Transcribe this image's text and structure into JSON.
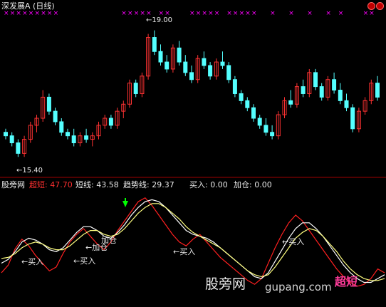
{
  "header": {
    "title": "深发展A (日线)",
    "max_label": "19.00",
    "min_label": "15.40"
  },
  "indicator": {
    "name": "股旁网",
    "super_short_label": "超短:",
    "super_short_value": "47.70",
    "short_label": "短线:",
    "short_value": "43.58",
    "trend_label": "趋势线:",
    "trend_value": "29.37",
    "buy_label": "买入:",
    "buy_value": "0.00",
    "add_label": "加仓:",
    "add_value": "0.00"
  },
  "annotations": {
    "buy": "买入",
    "add_position": "加仓"
  },
  "watermark": {
    "site_cn": "股旁网",
    "site_domain": "gupang.com",
    "logo_text": "超短"
  },
  "colors": {
    "background": "#000000",
    "up_candle": "#ff3232",
    "down_candle": "#54ffff",
    "signal_mark": "#ff00ff",
    "super_short_line": "#ff2020",
    "short_line": "#ffffff",
    "trend_line": "#ffff80",
    "divider": "#a00000",
    "arrow": "#00ff00"
  },
  "chart_data": [
    {
      "type": "candlestick",
      "title": "深发展A (日线)",
      "series": [
        {
          "name": "price",
          "values": [
            [
              16.1,
              16.2,
              15.9,
              16.0
            ],
            [
              16.0,
              16.1,
              15.7,
              15.8
            ],
            [
              15.8,
              15.9,
              15.4,
              15.5
            ],
            [
              15.5,
              16.0,
              15.4,
              15.9
            ],
            [
              15.9,
              16.4,
              15.8,
              16.3
            ],
            [
              16.3,
              16.6,
              16.1,
              16.5
            ],
            [
              16.5,
              17.3,
              16.4,
              17.1
            ],
            [
              17.1,
              17.2,
              16.6,
              16.7
            ],
            [
              16.7,
              16.8,
              16.3,
              16.4
            ],
            [
              16.4,
              16.5,
              16.0,
              16.1
            ],
            [
              16.1,
              16.2,
              15.9,
              16.0
            ],
            [
              16.0,
              16.2,
              15.7,
              15.8
            ],
            [
              15.8,
              16.1,
              15.7,
              16.0
            ],
            [
              16.0,
              16.2,
              15.8,
              15.9
            ],
            [
              15.9,
              16.1,
              15.7,
              16.0
            ],
            [
              16.0,
              16.4,
              15.9,
              16.3
            ],
            [
              16.3,
              16.6,
              16.2,
              16.5
            ],
            [
              16.5,
              16.6,
              16.2,
              16.3
            ],
            [
              16.3,
              16.8,
              16.2,
              16.7
            ],
            [
              16.7,
              17.0,
              16.5,
              16.9
            ],
            [
              16.9,
              17.6,
              16.8,
              17.5
            ],
            [
              17.5,
              17.6,
              17.1,
              17.2
            ],
            [
              17.2,
              17.8,
              17.1,
              17.7
            ],
            [
              17.7,
              18.9,
              17.6,
              18.8
            ],
            [
              18.8,
              19.0,
              18.3,
              18.4
            ],
            [
              18.4,
              18.6,
              18.0,
              18.1
            ],
            [
              18.1,
              18.3,
              17.8,
              17.9
            ],
            [
              17.9,
              18.6,
              17.8,
              18.5
            ],
            [
              18.5,
              18.7,
              18.0,
              18.1
            ],
            [
              18.1,
              18.3,
              17.7,
              17.8
            ],
            [
              17.8,
              18.0,
              17.5,
              17.6
            ],
            [
              17.6,
              18.3,
              17.5,
              18.2
            ],
            [
              18.2,
              18.4,
              17.9,
              18.0
            ],
            [
              18.0,
              18.1,
              17.6,
              17.7
            ],
            [
              17.7,
              18.2,
              17.6,
              18.1
            ],
            [
              18.1,
              18.4,
              17.9,
              18.0
            ],
            [
              18.0,
              18.1,
              17.5,
              17.6
            ],
            [
              17.6,
              17.7,
              17.1,
              17.2
            ],
            [
              17.2,
              17.3,
              16.9,
              17.0
            ],
            [
              17.0,
              17.1,
              16.7,
              16.8
            ],
            [
              16.8,
              16.9,
              16.4,
              16.5
            ],
            [
              16.5,
              16.6,
              16.2,
              16.3
            ],
            [
              16.3,
              16.5,
              16.0,
              16.1
            ],
            [
              16.1,
              16.3,
              15.9,
              16.0
            ],
            [
              16.0,
              16.7,
              15.9,
              16.6
            ],
            [
              16.6,
              17.1,
              16.5,
              17.0
            ],
            [
              17.0,
              17.3,
              16.8,
              16.9
            ],
            [
              16.9,
              17.5,
              16.8,
              17.4
            ],
            [
              17.4,
              17.6,
              17.1,
              17.2
            ],
            [
              17.2,
              17.9,
              17.1,
              17.8
            ],
            [
              17.8,
              17.9,
              17.3,
              17.4
            ],
            [
              17.4,
              17.5,
              17.0,
              17.1
            ],
            [
              17.1,
              17.7,
              17.0,
              17.6
            ],
            [
              17.6,
              17.8,
              17.2,
              17.3
            ],
            [
              17.3,
              17.5,
              16.9,
              17.0
            ],
            [
              17.0,
              17.2,
              16.7,
              16.8
            ],
            [
              16.8,
              16.9,
              16.1,
              16.2
            ],
            [
              16.2,
              16.8,
              16.1,
              16.7
            ],
            [
              16.7,
              17.1,
              16.6,
              17.0
            ],
            [
              17.0,
              17.6,
              16.9,
              17.5
            ],
            [
              17.5,
              17.7,
              17.0,
              17.1
            ]
          ]
        }
      ]
    },
    {
      "type": "line",
      "title": "股旁网",
      "series": [
        {
          "name": "超短",
          "values": [
            20,
            28,
            45,
            55,
            48,
            38,
            30,
            22,
            26,
            40,
            52,
            60,
            66,
            58,
            50,
            44,
            52,
            64,
            74,
            84,
            94,
            98,
            90,
            80,
            70,
            60,
            52,
            48,
            55,
            60,
            52,
            44,
            36,
            30,
            24,
            18,
            12,
            8,
            14,
            30,
            46,
            60,
            72,
            80,
            74,
            64,
            54,
            44,
            34,
            24,
            16,
            10,
            6,
            8,
            14,
            24,
            20
          ]
        },
        {
          "name": "短线",
          "values": [
            30,
            34,
            42,
            52,
            56,
            54,
            50,
            44,
            42,
            46,
            54,
            62,
            68,
            68,
            64,
            58,
            56,
            62,
            70,
            80,
            88,
            94,
            96,
            94,
            88,
            80,
            72,
            64,
            60,
            58,
            56,
            52,
            46,
            40,
            34,
            28,
            22,
            16,
            14,
            20,
            32,
            44,
            56,
            66,
            72,
            72,
            66,
            58,
            48,
            38,
            28,
            20,
            14,
            10,
            10,
            14,
            18
          ]
        },
        {
          "name": "趋势线",
          "values": [
            35,
            36,
            40,
            46,
            50,
            52,
            50,
            46,
            44,
            44,
            48,
            54,
            60,
            64,
            64,
            60,
            58,
            60,
            66,
            74,
            82,
            88,
            92,
            92,
            88,
            82,
            76,
            68,
            62,
            58,
            54,
            50,
            46,
            40,
            34,
            28,
            22,
            18,
            16,
            18,
            26,
            36,
            46,
            56,
            62,
            66,
            64,
            58,
            50,
            42,
            32,
            24,
            18,
            14,
            12,
            12,
            14
          ]
        }
      ],
      "ylim": [
        0,
        100
      ]
    }
  ]
}
